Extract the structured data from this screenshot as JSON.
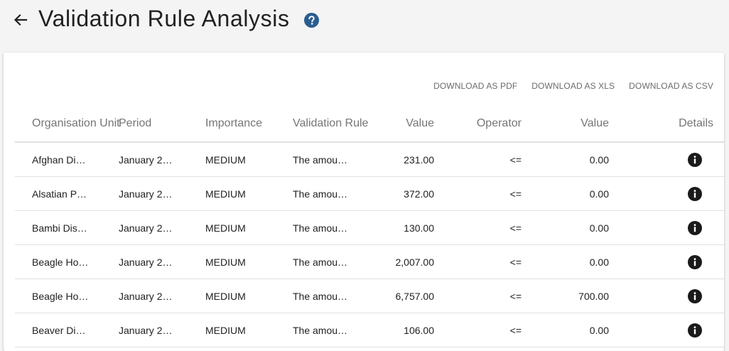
{
  "header": {
    "title": "Validation Rule Analysis",
    "back_icon": "arrow-left-icon",
    "help_icon": "help-circle-icon"
  },
  "downloads": {
    "pdf": "DOWNLOAD AS PDF",
    "xls": "DOWNLOAD AS XLS",
    "csv": "DOWNLOAD AS CSV"
  },
  "table": {
    "headers": {
      "org_unit": "Organisation Unit",
      "period": "Period",
      "importance": "Importance",
      "rule": "Validation Rule",
      "value1": "Value",
      "operator": "Operator",
      "value2": "Value",
      "details": "Details"
    },
    "rows": [
      {
        "org_unit": "Afghan Di…",
        "period": "January 2…",
        "importance": "MEDIUM",
        "rule": "The amou…",
        "value1": "231.00",
        "operator": "<=",
        "value2": "0.00"
      },
      {
        "org_unit": "Alsatian P…",
        "period": "January 2…",
        "importance": "MEDIUM",
        "rule": "The amou…",
        "value1": "372.00",
        "operator": "<=",
        "value2": "0.00"
      },
      {
        "org_unit": "Bambi Dis…",
        "period": "January 2…",
        "importance": "MEDIUM",
        "rule": "The amou…",
        "value1": "130.00",
        "operator": "<=",
        "value2": "0.00"
      },
      {
        "org_unit": "Beagle Ho…",
        "period": "January 2…",
        "importance": "MEDIUM",
        "rule": "The amou…",
        "value1": "2,007.00",
        "operator": "<=",
        "value2": "0.00"
      },
      {
        "org_unit": "Beagle Ho…",
        "period": "January 2…",
        "importance": "MEDIUM",
        "rule": "The amou…",
        "value1": "6,757.00",
        "operator": "<=",
        "value2": "700.00"
      },
      {
        "org_unit": "Beaver Di…",
        "period": "January 2…",
        "importance": "MEDIUM",
        "rule": "The amou…",
        "value1": "106.00",
        "operator": "<=",
        "value2": "0.00"
      }
    ],
    "details_icon": "info-icon"
  },
  "colors": {
    "background": "#f4f4f4",
    "card": "#ffffff",
    "help_icon": "#2a5d8f",
    "text": "#212121",
    "header_text": "#757575"
  }
}
